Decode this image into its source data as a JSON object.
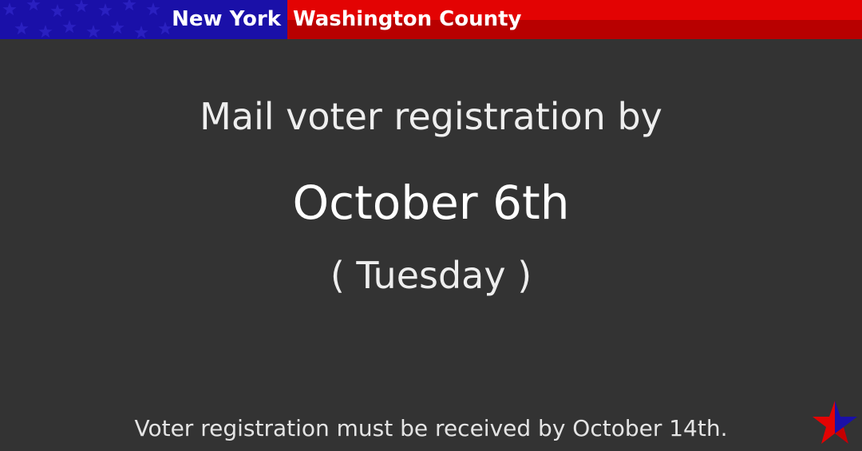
{
  "banner": {
    "state": "New York",
    "county": "Washington County",
    "colors": {
      "blue": "#1a10a8",
      "red": "#e30303",
      "dark_red": "#b80000"
    }
  },
  "main": {
    "line1": "Mail voter registration by",
    "deadline": "October 6th",
    "weekday": "( Tuesday )"
  },
  "footer": {
    "note": "Voter registration must be received by October 14th."
  },
  "logo": {
    "icon": "star-icon",
    "colors": [
      "#1a10a8",
      "#e30303"
    ]
  }
}
